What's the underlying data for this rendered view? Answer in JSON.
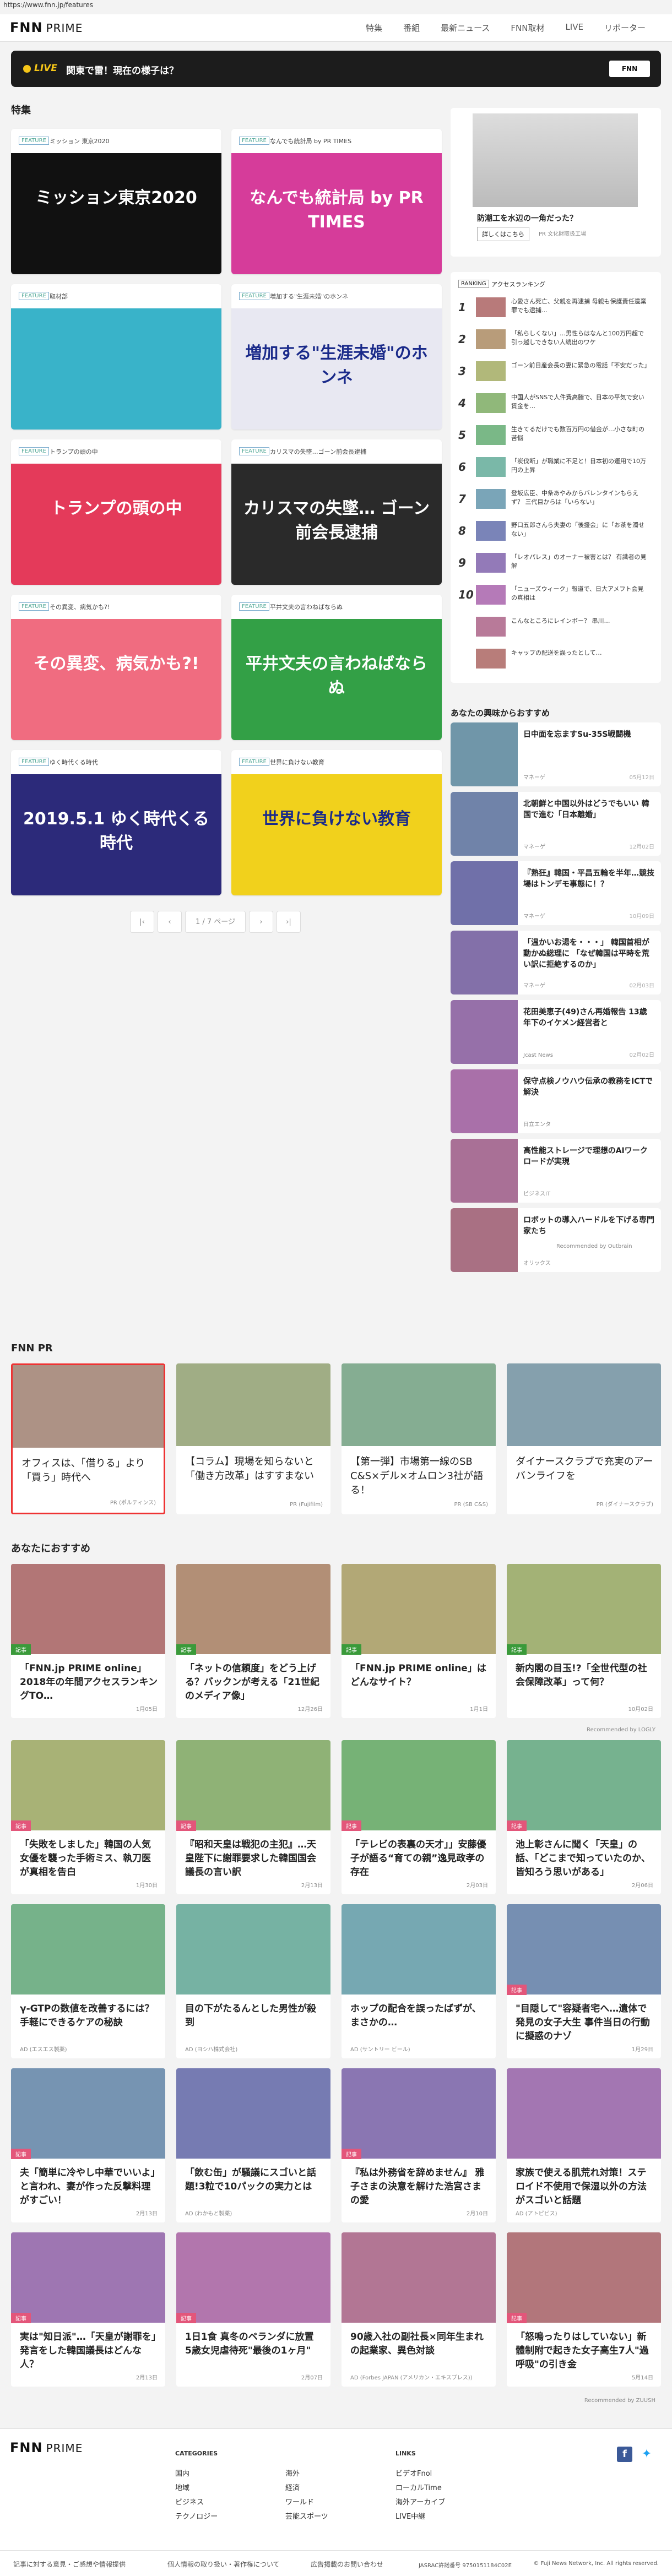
{
  "url": "https://www.fnn.jp/features",
  "header": {
    "logo": "FNN",
    "logo2": "PRIME",
    "nav": [
      "特集",
      "番組",
      "最新ニュース",
      "FNN取材",
      "LIVE",
      "リポーター"
    ]
  },
  "live": {
    "label": "LIVE",
    "title": "関東で雷！現在の様子は？",
    "badge": "FNN"
  },
  "features": {
    "title": "特集",
    "cards": [
      {
        "tag": "FEATURE",
        "title": "ミッション 東京2020",
        "img": "ミッション東京2020",
        "bg": "#111"
      },
      {
        "tag": "FEATURE",
        "title": "なんでも統計局 by PR TIMES",
        "img": "なんでも統計局 by PR TIMES",
        "bg": "#d63c9a"
      },
      {
        "tag": "FEATURE",
        "title": "取材部",
        "img": "",
        "bg": "#39b3c9"
      },
      {
        "tag": "FEATURE",
        "title": "増加する\"生涯未婚\"のホンネ",
        "img": "増加する\"生涯未婚\"のホンネ",
        "bg": "#e8e8f2"
      },
      {
        "tag": "FEATURE",
        "title": "トランプの頭の中",
        "img": "トランプの頭の中",
        "bg": "#e43a5a"
      },
      {
        "tag": "FEATURE",
        "title": "カリスマの失墜…ゴーン前会長逮捕",
        "img": "カリスマの失墜… ゴーン前会長逮捕",
        "bg": "#2a2a2a"
      },
      {
        "tag": "FEATURE",
        "title": "その異変、病気かも?!",
        "img": "その異変、病気かも?!",
        "bg": "#f06c80"
      },
      {
        "tag": "FEATURE",
        "title": "平井文夫の言わねばならぬ",
        "img": "平井文夫の言わねばならぬ",
        "bg": "#33a046"
      },
      {
        "tag": "FEATURE",
        "title": "ゆく時代くる時代",
        "img": "2019.5.1 ゆく時代くる時代",
        "bg": "#2c2a7a"
      },
      {
        "tag": "FEATURE",
        "title": "世界に負けない教育",
        "img": "世界に負けない教育",
        "bg": "#f1d11c"
      }
    ]
  },
  "pager": {
    "first": "|‹",
    "prev": "‹",
    "page": "1 / 7 ページ",
    "next": "›",
    "last": "›|"
  },
  "ad": {
    "title": "防潮工を水辺の一角だった？",
    "button": "詳しくはこちら",
    "sub": "PR 文化財取扱工場"
  },
  "ranking": {
    "tag": "RANKING",
    "title": "アクセスランキング",
    "items": [
      "心愛さん死亡、父親を再逮捕 母親も保護責任遺棄罪でも逮捕…",
      "「私らしくない」…男性らはなんと100万円超で引っ越しできない人続出のワケ",
      "ゴーン前日産会長の妻に緊急の電話「不安だった」",
      "中国人がSNSで人件費高騰で、日本の平気で安い賃金を…",
      "生きてるだけでも数百万円の借金が…小さな町の苦悩",
      "「炭伐断」が職業に不足と！日本初の運用で10万円の上昇",
      "登坂広臣、中条あやみからバレンタインもらえず？ 三代目からは「いらない」",
      "野口五郎さんら夫妻の「後援会」に「お茶を濁せない」",
      "「レオパレス」のオーナー被害とは？ 有識者の見解",
      "「ニューズウィーク」報道で、日大アメフト会見の真相は",
      "こんなところにレインボー？ 串川…",
      "キャップの配送を誤ったとして…"
    ]
  },
  "recommend": {
    "title": "あなたの興味からおすすめ",
    "items": [
      {
        "t": "日中面を忘ますSu-35S戦闘機",
        "s": "マネーゲ",
        "d": "05月12日"
      },
      {
        "t": "北朝鮮と中国以外はどうでもいい 韓国で進む「日本離婚」",
        "s": "マネーゲ",
        "d": "12月02日"
      },
      {
        "t": "『熟狂』韓国・平昌五輪を半年…競技場はトンデモ事態に！？",
        "s": "マネーゲ",
        "d": "10月09日"
      },
      {
        "t": "「温かいお湯を・・・」 韓国首相が動かぬ総理に 「なぜ韓国は平時を荒い訳に拒絶するのか」",
        "s": "マネーゲ",
        "d": "02月03日"
      },
      {
        "t": "花田美恵子(49)さん再婚報告 13歳年下のイケメン経営者と",
        "s": "Jcast News",
        "d": "02月02日"
      },
      {
        "t": "保守点検ノウハウ伝承の教務をICTで解決",
        "s": "日立エンタ",
        "d": ""
      },
      {
        "t": "高性能ストレージで理想のAIワークロードが実現",
        "s": "ビジネスIT",
        "d": ""
      },
      {
        "t": "ロボットの導入ハードルを下げる専門家たち",
        "s": "オリックス",
        "d": ""
      }
    ],
    "footer": "Recommended by Outbrain"
  },
  "pr": {
    "title": "FNN PR",
    "items": [
      {
        "t": "オフィスは、「借りる」より「買う」時代へ",
        "s": "PR (ポルティンス)"
      },
      {
        "t": "【コラム】現場を知らないと「働き方改革」はすすまない",
        "s": "PR (Fujifilm)"
      },
      {
        "t": "【第一弾】市場第一線のSB C&S×デル×オムロン3社が語る！",
        "s": "PR (SB C&S)"
      },
      {
        "t": "ダイナースクラブで充実のアーバンライフを",
        "s": "PR (ダイナースクラブ)"
      }
    ]
  },
  "osusume": {
    "title": "あなたにおすすめ",
    "rows": [
      [
        {
          "t": "「FNN.jp PRIME online」2018年の年間アクセスランキングTO…",
          "lab": "記事",
          "s": "",
          "d": "1月05日"
        },
        {
          "t": "「ネットの信頼度」をどう上げる？バックンが考える「21世紀のメディア像」",
          "lab": "記事",
          "s": "",
          "d": "12月26日"
        },
        {
          "t": "「FNN.jp PRIME online」はどんなサイト？",
          "lab": "記事",
          "s": "",
          "d": "1月1日"
        },
        {
          "t": "新内閣の目玉!?「全世代型の社会保障改革」って何？",
          "lab": "記事",
          "s": "",
          "d": "10月02日"
        }
      ],
      [
        {
          "t": "「失敗をしました」韓国の人気女優を襲った手術ミス、執刀医が真相を告白",
          "lab": "記事",
          "s": "",
          "d": "1月30日"
        },
        {
          "t": "『昭和天皇は戦犯の主犯』…天皇陛下に謝罪要求した韓国国会議長の言い訳",
          "lab": "記事",
          "s": "",
          "d": "2月13日"
        },
        {
          "t": "「テレビの表裏の天才」」安藤優子が語る“育ての親”逸見政孝の存在",
          "lab": "記事",
          "s": "",
          "d": "2月03日"
        },
        {
          "t": "池上彰さんに聞く「天皇」の話、「どこまで知っていたのか、皆知ろう思いがある」",
          "lab": "記事",
          "s": "",
          "d": "2月06日"
        }
      ],
      [
        {
          "t": "γ-GTPの数値を改善するには？手軽にできるケアの秘訣",
          "lab": "",
          "s": "AD (エスエス製薬)",
          "d": ""
        },
        {
          "t": "目の下がたるんとした男性が殺到",
          "lab": "",
          "s": "AD (ヨシハ株式会社)",
          "d": ""
        },
        {
          "t": "ホップの配合を誤ったばずが、まさかの…",
          "lab": "",
          "s": "AD (サントリー ビール)",
          "d": ""
        },
        {
          "t": "\"目隠して\"容疑者宅へ…遺体で発見の女子大生 事件当日の行動に擬惑のナゾ",
          "lab": "記事",
          "s": "",
          "d": "1月29日"
        }
      ],
      [
        {
          "t": "夫「簡単に冷やし中華でいいよ」と言われ、妻が作った反撃料理がすごい！",
          "lab": "記事",
          "s": "",
          "d": "2月13日"
        },
        {
          "t": "「飲む缶」が騒議にスゴいと話題!3粒で10パックの実力とは",
          "lab": "",
          "s": "AD (わかもと製薬)",
          "d": ""
        },
        {
          "t": "『私は外務省を辞めません』 雅子さまの決意を解けた浩宮さまの愛",
          "lab": "記事",
          "s": "",
          "d": "2月10日"
        },
        {
          "t": "家族で使える肌荒れ対策！ステロイド不使用で保湿以外の方法がスゴいと話題",
          "lab": "",
          "s": "AD (アトピビス)",
          "d": ""
        }
      ],
      [
        {
          "t": "実は\"知日派\"…「天皇が謝罪を」発言をした韓国議長はどんな人？",
          "lab": "記事",
          "s": "",
          "d": "2月13日"
        },
        {
          "t": "1日1食 真冬のベランダに放置 5歳女児虐待死\"最後の1ヶ月\"",
          "lab": "記事",
          "s": "",
          "d": "2月07日"
        },
        {
          "t": "90歳入社の副社長×同年生まれの起業家、異色対談",
          "lab": "",
          "s": "AD (Forbes JAPAN (アメリカン・エキスプレス))",
          "d": ""
        },
        {
          "t": "「怒鳴ったりはしていない」新體制附で起きた女子高生7人\"過呼吸\"の引き金",
          "lab": "記事",
          "s": "",
          "d": "5月14日"
        }
      ]
    ],
    "rec_by": "Recommended by LOGLY",
    "rec_by2": "Recommended by ZUUSH"
  },
  "footer": {
    "logo": "FNN",
    "logo2": "PRIME",
    "cat_title": "CATEGORIES",
    "cats": [
      "国内",
      "海外",
      "地域",
      "経済",
      "ビジネス",
      "ワールド",
      "テクノロジー",
      "芸能スポーツ"
    ],
    "links_title": "LINKS",
    "links": [
      "ビデオFnol",
      "ローカルTime",
      "海外アーカイブ",
      "LIVE中継"
    ],
    "bottom": [
      "記事に対する意見・ご感想や情報提供",
      "個人情報の取り扱い・著作権について",
      "広告掲載のお問い合わせ"
    ],
    "copyright": "© Fuji News Network, Inc. All rights reserved.",
    "jasrac": "JASRAC許諾番号 9750151184C02E"
  }
}
